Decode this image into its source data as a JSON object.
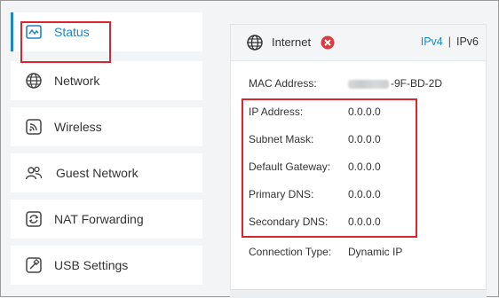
{
  "sidebar": {
    "items": [
      {
        "label": "Status",
        "icon": "status-icon"
      },
      {
        "label": "Network",
        "icon": "globe-icon"
      },
      {
        "label": "Wireless",
        "icon": "wireless-icon"
      },
      {
        "label": "Guest Network",
        "icon": "guest-network-icon"
      },
      {
        "label": "NAT Forwarding",
        "icon": "nat-forwarding-icon"
      },
      {
        "label": "USB Settings",
        "icon": "usb-settings-icon"
      }
    ]
  },
  "panel": {
    "title": "Internet",
    "status_icon": "error-icon",
    "tab_ipv4": "IPv4",
    "tab_separator": "|",
    "tab_ipv6": "IPv6",
    "mac": {
      "label": "MAC Address:",
      "value": "-9F-BD-2D"
    },
    "ip": {
      "label": "IP Address:",
      "value": "0.0.0.0"
    },
    "subnet": {
      "label": "Subnet Mask:",
      "value": "0.0.0.0"
    },
    "gateway": {
      "label": "Default Gateway:",
      "value": "0.0.0.0"
    },
    "dns1": {
      "label": "Primary DNS:",
      "value": "0.0.0.0"
    },
    "dns2": {
      "label": "Secondary DNS:",
      "value": "0.0.0.0"
    },
    "conn": {
      "label": "Connection Type:",
      "value": "Dynamic IP"
    }
  },
  "colors": {
    "accent": "#1d86c5",
    "highlight": "#d9262e",
    "error": "#e0383e"
  }
}
